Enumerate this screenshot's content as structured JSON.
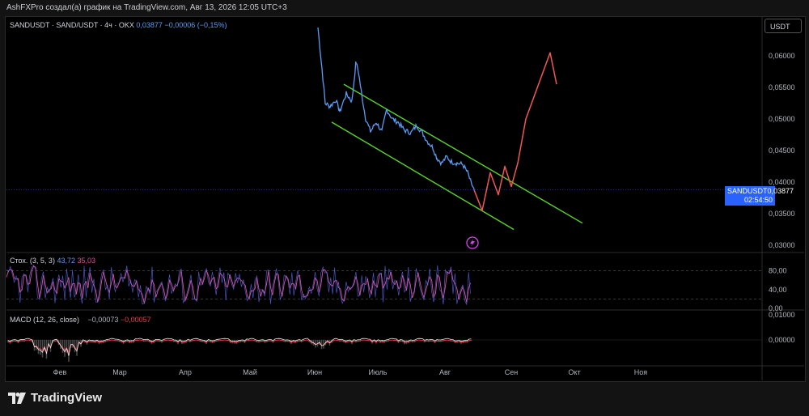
{
  "header": {
    "publish_text": "AshFXPro создал(а) график на TradingView.com, Авг 13, 2026 12:05 UTC+3"
  },
  "main_legend": {
    "symbol": "SANDUSDT · SAND/USDT · 4ч · OKX",
    "price": "0,03877",
    "change": "−0,00006 (−0,15%)"
  },
  "currency_button": "USDT",
  "price_label": {
    "symbol": "SANDUSDT",
    "price": "0,03877",
    "countdown": "02:54:50"
  },
  "price_axis": [
    "0,06000",
    "0,05500",
    "0,05000",
    "0,04500",
    "0,04000",
    "0,03500",
    "0,03000"
  ],
  "stoch": {
    "label": "Стох. (3, 5, 3)",
    "k": "43,72",
    "d": "35,03",
    "axis": [
      "80,00",
      "40,00",
      "0,00"
    ]
  },
  "macd": {
    "label": "MACD (12, 26, close)",
    "macd": "−0,00073",
    "signal": "−0,00057",
    "axis": [
      "0,01000",
      "0,00000"
    ]
  },
  "time_axis": [
    "Фев",
    "Мар",
    "Апр",
    "Май",
    "Июн",
    "Июль",
    "Авг",
    "Сен",
    "Окт",
    "Ноя"
  ],
  "footer": {
    "brand": "TradingView"
  },
  "colors": {
    "price_line": "#5b9cf6",
    "channel": "#5ad32a",
    "projection": "#f25757",
    "stoch_k": "#5b6cf6",
    "stoch_d": "#e0529c",
    "macd_hist_neg": "#4a4a4a"
  },
  "chart_data": {
    "type": "line",
    "title": "SANDUSDT · SAND/USDT · 4ч · OKX",
    "x": [
      "Июн",
      "Июн",
      "Июн",
      "Июль",
      "Июль",
      "Июль",
      "Авг",
      "Авг",
      "Авг"
    ],
    "series": [
      {
        "name": "SANDUSDT",
        "values": [
          0.066,
          0.052,
          0.053,
          0.055,
          0.0505,
          0.049,
          0.0458,
          0.0435,
          0.03877
        ]
      }
    ],
    "ylim": [
      0.03,
      0.063
    ],
    "current_price": 0.03877,
    "channel": {
      "upper": [
        0.0555,
        0.0335
      ],
      "lower": [
        0.0495,
        0.0325
      ]
    },
    "projection": [
      0.03877,
      0.0355,
      0.0415,
      0.038,
      0.0425,
      0.0393,
      0.043,
      0.05,
      0.0605,
      0.0555
    ],
    "stochastic": {
      "k": 43.72,
      "d": 35.03,
      "levels": [
        80,
        20
      ],
      "ylim": [
        0,
        100
      ]
    },
    "macd": {
      "macd": -0.00073,
      "signal": -0.00057
    }
  }
}
